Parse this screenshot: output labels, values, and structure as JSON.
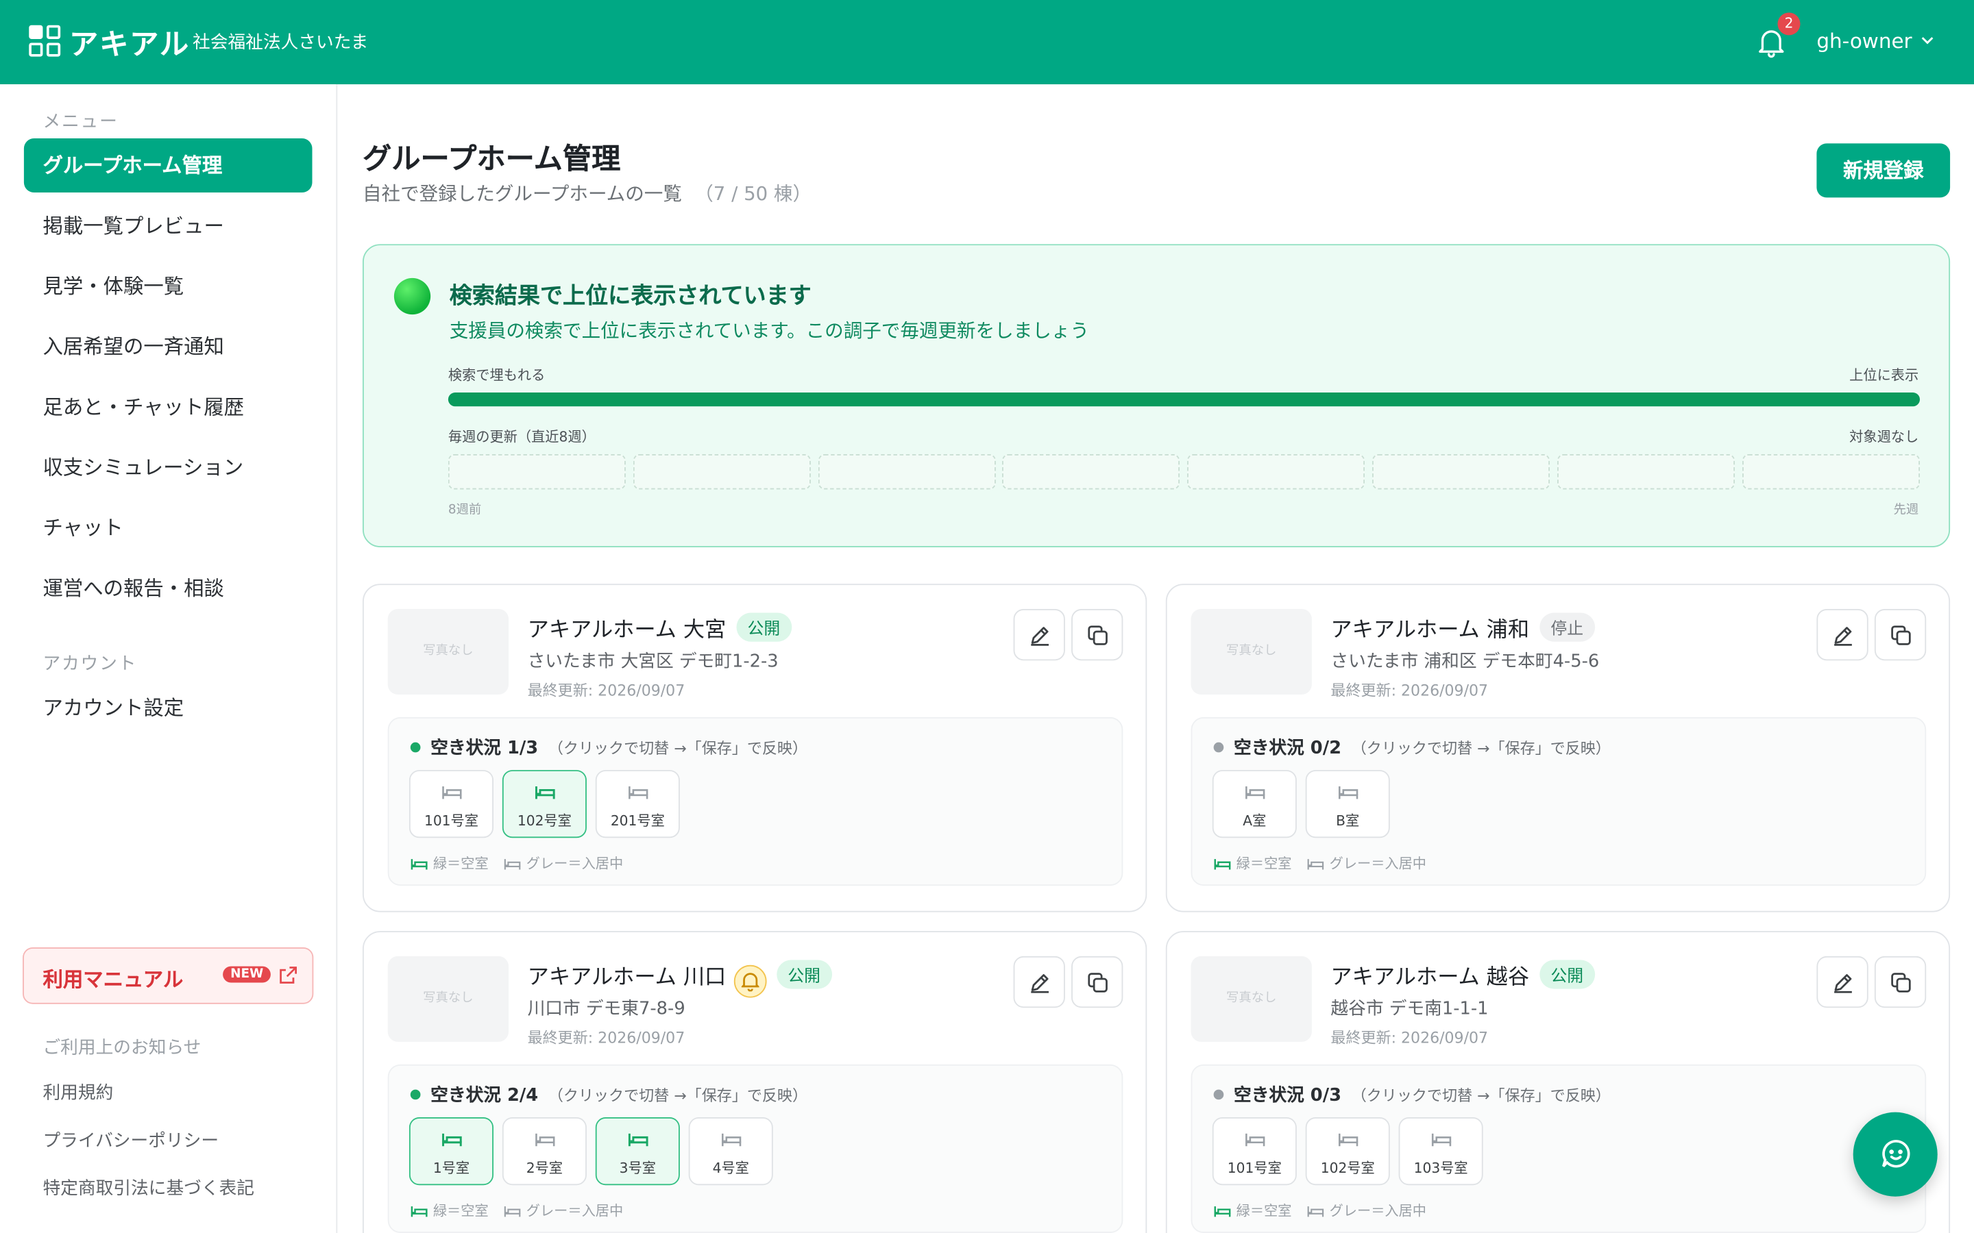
{
  "header": {
    "brand": "アキアル",
    "org": "社会福祉法人さいたま",
    "notifications": "2",
    "user": "gh-owner"
  },
  "sidebar": {
    "menu_heading": "メニュー",
    "items": [
      {
        "label": "グループホーム管理"
      },
      {
        "label": "掲載一覧プレビュー"
      },
      {
        "label": "見学・体験一覧"
      },
      {
        "label": "入居希望の一斉通知"
      },
      {
        "label": "足あと・チャット履歴"
      },
      {
        "label": "収支シミュレーション"
      },
      {
        "label": "チャット"
      },
      {
        "label": "運営への報告・相談"
      }
    ],
    "account_heading": "アカウント",
    "account_item": "アカウント設定",
    "manual": {
      "label": "利用マニュアル",
      "badge": "NEW"
    },
    "notice_heading": "ご利用上のお知らせ",
    "links": [
      "利用規約",
      "プライバシーポリシー",
      "特定商取引法に基づく表記"
    ]
  },
  "page": {
    "title": "グループホーム管理",
    "subtitle": "自社で登録したグループホームの一覧",
    "count": "（7 / 50 棟）",
    "new_button": "新規登録"
  },
  "status": {
    "title": "検索結果で上位に表示されています",
    "desc": "支援員の検索で上位に表示されています。この調子で毎週更新をしましょう",
    "left_label": "検索で埋もれる",
    "right_label": "上位に表示",
    "level": 1.0,
    "weeks_label": "毎週の更新（直近8週）",
    "weeks_status": "対象週なし",
    "weeks_start": "8週前",
    "weeks_end": "先週"
  },
  "cards": [
    {
      "name": "アキアルホーム 大宮",
      "tag": "公開",
      "photo": "写真なし",
      "address": "さいたま市 大宮区 デモ町1-2-3",
      "updated": "最終更新: 2026/09/07",
      "vacancy": "空き状況 1/3",
      "hint": "（クリックで切替 →「保存」で反映）",
      "rooms": [
        "101号室",
        "102号室",
        "201号室"
      ]
    },
    {
      "name": "アキアルホーム 浦和",
      "tag": "停止",
      "photo": "写真なし",
      "address": "さいたま市 浦和区 デモ本町4-5-6",
      "updated": "最終更新: 2026/09/07",
      "vacancy": "空き状況 0/2",
      "hint": "（クリックで切替 →「保存」で反映）",
      "rooms": [
        "A室",
        "B室"
      ]
    },
    {
      "name": "アキアルホーム 川口",
      "tag": "公開",
      "photo": "写真なし",
      "address": "川口市 デモ東7-8-9",
      "updated": "最終更新: 2026/09/07",
      "vacancy": "空き状況 2/4",
      "hint": "（クリックで切替 →「保存」で反映）",
      "rooms": [
        "1号室",
        "2号室",
        "3号室",
        "4号室"
      ]
    },
    {
      "name": "アキアルホーム 越谷",
      "tag": "公開",
      "photo": "写真なし",
      "address": "越谷市 デモ南1-1-1",
      "updated": "最終更新: 2026/09/07",
      "vacancy": "空き状況 0/3",
      "hint": "（クリックで切替 →「保存」で反映）",
      "rooms": [
        "101号室",
        "102号室",
        "103号室"
      ]
    }
  ],
  "legend": {
    "free": "緑＝空室",
    "occupied": "グレー＝入居中"
  },
  "colors": {
    "accent": "#00a884",
    "free": "#1aa866",
    "occupied": "#9aa0a6",
    "alert": "#e5484d"
  }
}
